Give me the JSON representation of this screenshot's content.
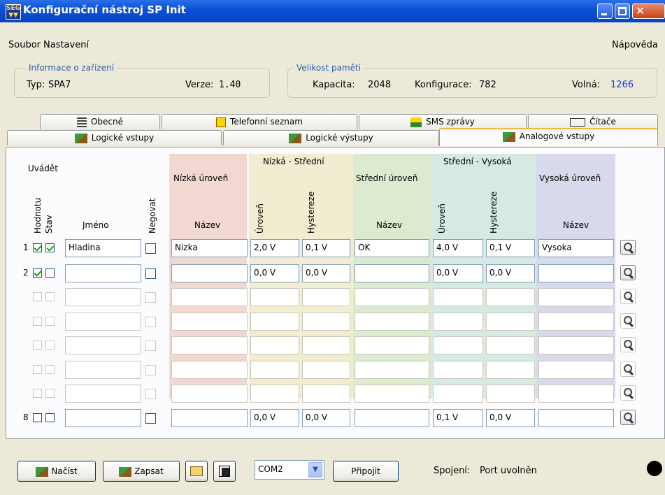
{
  "window": {
    "title": "Konfigurační nástroj SP Init",
    "icon": "app-logo-icon"
  },
  "menu": {
    "file": "Soubor",
    "settings": "Nastavení",
    "help": "Nápověda"
  },
  "device_info": {
    "title": "Informace o zařízení",
    "type_label": "Typ:",
    "type_value": "SPA7",
    "version_label": "Verze:",
    "version_value": "1.40"
  },
  "memory": {
    "title": "Velikost paměti",
    "capacity_label": "Kapacita:",
    "capacity_value": "2048",
    "config_label": "Konfigurace:",
    "config_value": "782",
    "free_label": "Volná:",
    "free_value": "1266",
    "free_color": "#1a3ad8"
  },
  "tabs_row1": [
    "Obecné",
    "Telefonní seznam",
    "SMS zprávy",
    "Čítače"
  ],
  "tabs_row2": [
    "Logické vstupy",
    "Logické výstupy",
    "Analogové vstupy"
  ],
  "active_tab": "Analogové vstupy",
  "headers": {
    "uvadet": "Uvádět",
    "hodnotu": "Hodnotu",
    "stav": "Stav",
    "jmeno": "Jméno",
    "negovat": "Negovat",
    "low": "Nízká úroveň",
    "low_name": "Název",
    "low_mid": "Nízká - Střední",
    "low_mid_level": "Úroveň",
    "low_mid_hyst": "Hystereze",
    "mid": "Střední úroveň",
    "mid_name": "Název",
    "mid_high": "Střední - Vysoká",
    "mid_high_level": "Úroveň",
    "mid_high_hyst": "Hystereze",
    "high": "Vysoká úroveň",
    "high_name": "Název"
  },
  "column_colors": {
    "low": "#f2d8d3",
    "low_mid": "#f2ecd0",
    "mid": "#dcebcf",
    "mid_high": "#d6eae2",
    "high": "#d8d9ea"
  },
  "rows": [
    {
      "num": "1",
      "enabled": true,
      "hodnotu": true,
      "stav": true,
      "name": "Hladina",
      "negovat": false,
      "low_name": "Nizka",
      "lm_level": "2,0 V",
      "lm_hyst": "0,1 V",
      "mid_name": "OK",
      "mh_level": "4,0 V",
      "mh_hyst": "0,1 V",
      "high_name": "Vysoka"
    },
    {
      "num": "2",
      "enabled": true,
      "hodnotu": true,
      "stav": false,
      "name": "",
      "negovat": false,
      "low_name": "",
      "lm_level": "0,0 V",
      "lm_hyst": "0,0 V",
      "mid_name": "",
      "mh_level": "0,0 V",
      "mh_hyst": "0,0 V",
      "high_name": ""
    },
    {
      "num": "",
      "enabled": false,
      "hodnotu": false,
      "stav": false,
      "name": "",
      "negovat": false,
      "low_name": "",
      "lm_level": "",
      "lm_hyst": "",
      "mid_name": "",
      "mh_level": "",
      "mh_hyst": "",
      "high_name": ""
    },
    {
      "num": "",
      "enabled": false,
      "hodnotu": false,
      "stav": false,
      "name": "",
      "negovat": false,
      "low_name": "",
      "lm_level": "",
      "lm_hyst": "",
      "mid_name": "",
      "mh_level": "",
      "mh_hyst": "",
      "high_name": ""
    },
    {
      "num": "",
      "enabled": false,
      "hodnotu": false,
      "stav": false,
      "name": "",
      "negovat": false,
      "low_name": "",
      "lm_level": "",
      "lm_hyst": "",
      "mid_name": "",
      "mh_level": "",
      "mh_hyst": "",
      "high_name": ""
    },
    {
      "num": "",
      "enabled": false,
      "hodnotu": false,
      "stav": false,
      "name": "",
      "negovat": false,
      "low_name": "",
      "lm_level": "",
      "lm_hyst": "",
      "mid_name": "",
      "mh_level": "",
      "mh_hyst": "",
      "high_name": ""
    },
    {
      "num": "",
      "enabled": false,
      "hodnotu": false,
      "stav": false,
      "name": "",
      "negovat": false,
      "low_name": "",
      "lm_level": "",
      "lm_hyst": "",
      "mid_name": "",
      "mh_level": "",
      "mh_hyst": "",
      "high_name": ""
    },
    {
      "num": "8",
      "enabled": true,
      "hodnotu": false,
      "stav": false,
      "name": "",
      "negovat": false,
      "low_name": "",
      "lm_level": "0,0 V",
      "lm_hyst": "0,0 V",
      "mid_name": "",
      "mh_level": "0,1 V",
      "mh_hyst": "0,0 V",
      "high_name": ""
    }
  ],
  "toolbar": {
    "load": "Načíst",
    "write": "Zapsat",
    "port": "COM2",
    "connect": "Připojit",
    "status_label": "Spojení:",
    "status_value": "Port uvolněn",
    "status_color": "#000000"
  }
}
